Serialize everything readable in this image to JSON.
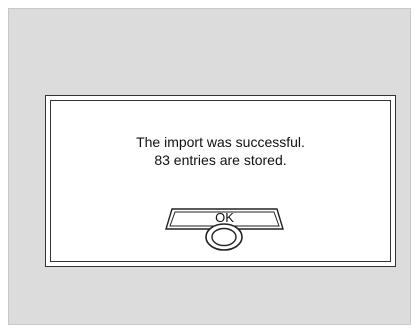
{
  "dialog": {
    "message_line1": "The import was successful.",
    "message_line2": "83 entries are stored.",
    "ok_label": "OK"
  },
  "icons": {
    "ok_knob": "push-knob-icon"
  }
}
